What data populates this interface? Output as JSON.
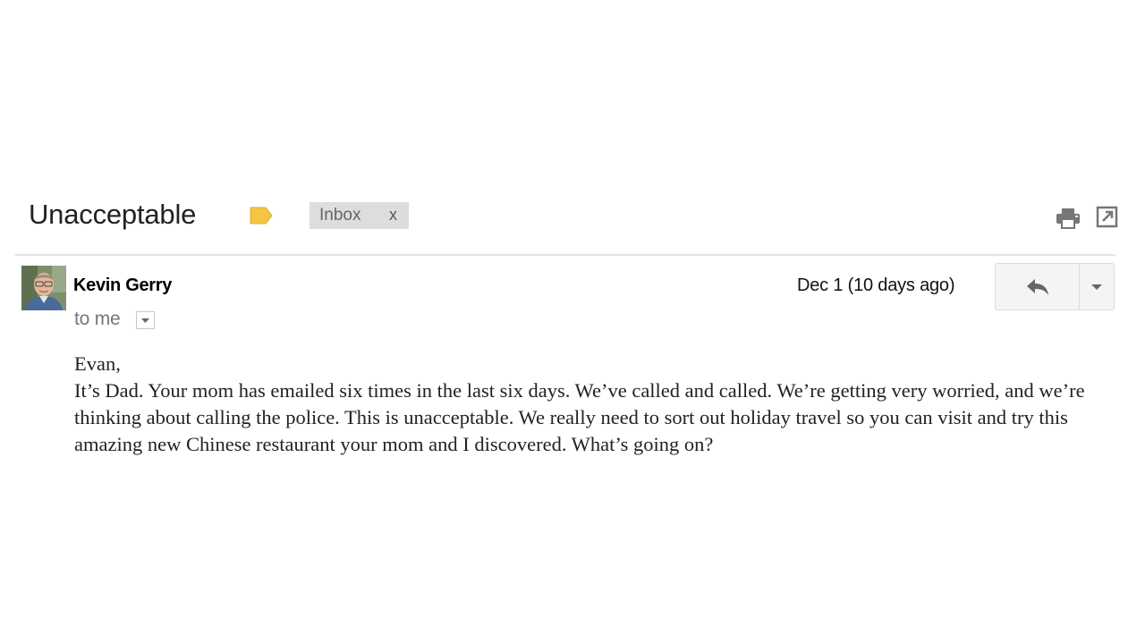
{
  "email": {
    "subject": "Unacceptable",
    "label_chip": {
      "text": "Inbox",
      "remove_symbol": "x"
    },
    "sender_name": "Kevin Gerry",
    "date_text": "Dec 1 (10 days ago)",
    "recipient_text": "to me",
    "body": {
      "greeting": "Evan,",
      "paragraph": "It’s Dad. Your mom has emailed six times in the last six days. We’ve called and called. We’re getting very worried, and we’re thinking about calling the police. This is unacceptable. We really need to sort out holiday travel so you can visit and try this amazing new Chinese restaurant your mom and I discovered. What’s going on?"
    }
  },
  "icons": {
    "label_tag": "label-tag-icon",
    "print": "print-icon",
    "new_window": "new-window-icon",
    "reply": "reply-icon",
    "more": "chevron-down-icon",
    "recipient_details": "chevron-down-icon"
  },
  "colors": {
    "label_tag": "#f5c542",
    "chip_background": "#dddddd",
    "divider": "#e3e3e3",
    "button_background": "#f4f4f4"
  }
}
